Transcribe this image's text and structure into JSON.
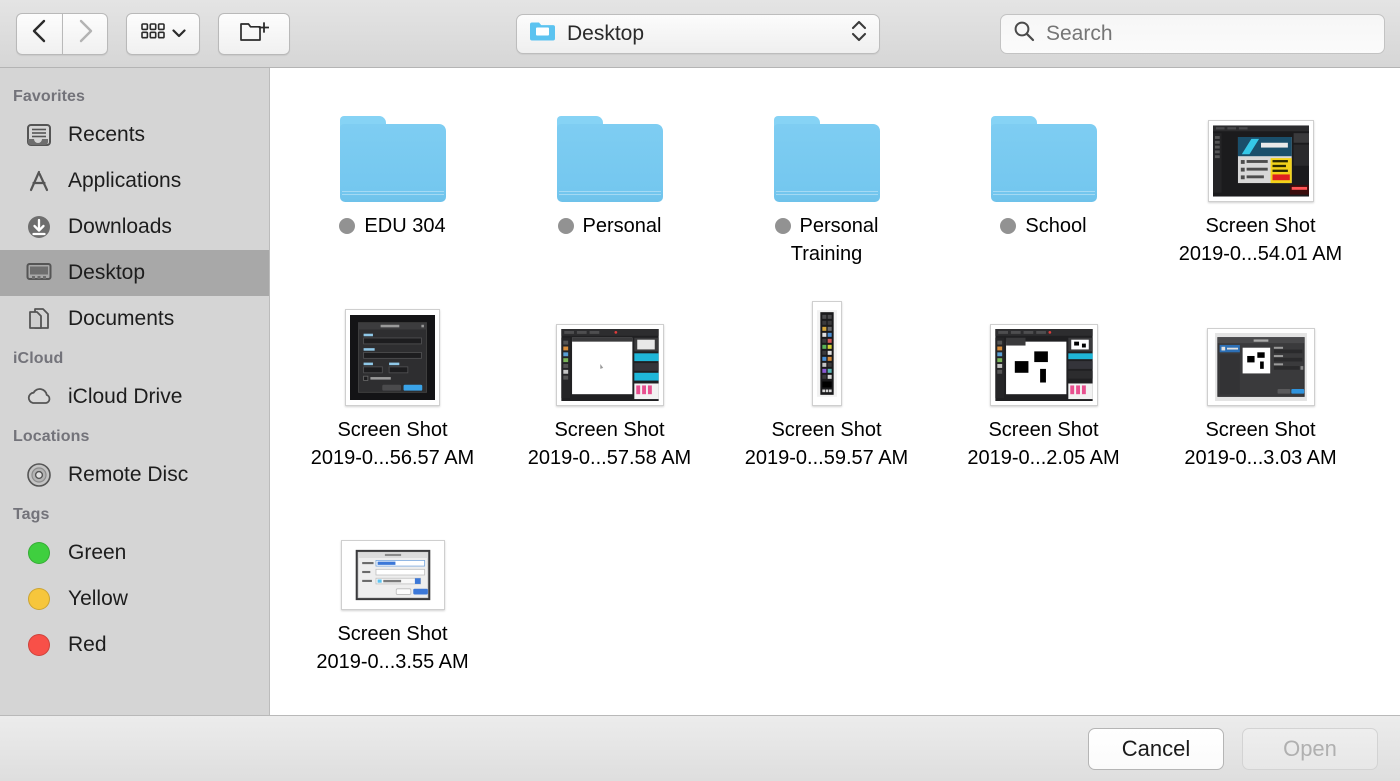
{
  "toolbar": {
    "back_icon": "chevron-left-icon",
    "forward_icon": "chevron-right-icon",
    "view_icon": "icon-view-grid-icon",
    "new_folder_icon": "new-folder-icon",
    "path_label": "Desktop",
    "path_icon": "blue-folder-icon",
    "search_placeholder": "Search",
    "search_icon": "search-icon"
  },
  "sidebar": {
    "sections": [
      {
        "header": "Favorites",
        "items": [
          {
            "label": "Recents",
            "icon": "recents-tray-icon",
            "selected": false
          },
          {
            "label": "Applications",
            "icon": "applications-icon",
            "selected": false
          },
          {
            "label": "Downloads",
            "icon": "downloads-icon",
            "selected": false
          },
          {
            "label": "Desktop",
            "icon": "desktop-icon",
            "selected": true
          },
          {
            "label": "Documents",
            "icon": "documents-icon",
            "selected": false
          }
        ]
      },
      {
        "header": "iCloud",
        "items": [
          {
            "label": "iCloud Drive",
            "icon": "cloud-icon",
            "selected": false
          }
        ]
      },
      {
        "header": "Locations",
        "items": [
          {
            "label": "Remote Disc",
            "icon": "disc-icon",
            "selected": false
          }
        ]
      },
      {
        "header": "Tags",
        "items": [
          {
            "label": "Green",
            "icon": "tag-dot-icon",
            "color": "#3FCF3F",
            "selected": false
          },
          {
            "label": "Yellow",
            "icon": "tag-dot-icon",
            "color": "#F6C63C",
            "selected": false
          },
          {
            "label": "Red",
            "icon": "tag-dot-icon",
            "color": "#F85048",
            "selected": false
          }
        ]
      }
    ]
  },
  "files": [
    {
      "kind": "folder",
      "name_lines": [
        "EDU 304"
      ],
      "tag_dot": true,
      "tag_color": "#929292"
    },
    {
      "kind": "folder",
      "name_lines": [
        "Personal"
      ],
      "tag_dot": true,
      "tag_color": "#929292"
    },
    {
      "kind": "folder",
      "name_lines": [
        "Personal",
        "Training"
      ],
      "tag_dot": true,
      "tag_color": "#929292"
    },
    {
      "kind": "folder",
      "name_lines": [
        "School"
      ],
      "tag_dot": true,
      "tag_color": "#929292"
    },
    {
      "kind": "image",
      "thumb": "dark-app-splash",
      "name_lines": [
        "Screen Shot",
        "2019-0...54.01 AM"
      ],
      "tag_dot": false
    },
    {
      "kind": "image",
      "thumb": "dark-new-image-dialog",
      "name_lines": [
        "Screen Shot",
        "2019-0...56.57 AM"
      ],
      "tag_dot": false
    },
    {
      "kind": "image",
      "thumb": "editor-blank-canvas",
      "name_lines": [
        "Screen Shot",
        "2019-0...57.58 AM"
      ],
      "tag_dot": false
    },
    {
      "kind": "image",
      "thumb": "vertical-toolbar",
      "name_lines": [
        "Screen Shot",
        "2019-0...59.57 AM"
      ],
      "tag_dot": false
    },
    {
      "kind": "image",
      "thumb": "editor-black-shapes",
      "name_lines": [
        "Screen Shot",
        "2019-0...2.05 AM"
      ],
      "tag_dot": false
    },
    {
      "kind": "image",
      "thumb": "export-dialog",
      "name_lines": [
        "Screen Shot",
        "2019-0...3.03 AM"
      ],
      "tag_dot": false
    },
    {
      "kind": "image",
      "thumb": "save-as-sheet",
      "name_lines": [
        "Screen Shot",
        "2019-0...3.55 AM"
      ],
      "tag_dot": false
    }
  ],
  "footer": {
    "cancel_label": "Cancel",
    "open_label": "Open",
    "open_disabled": true
  }
}
